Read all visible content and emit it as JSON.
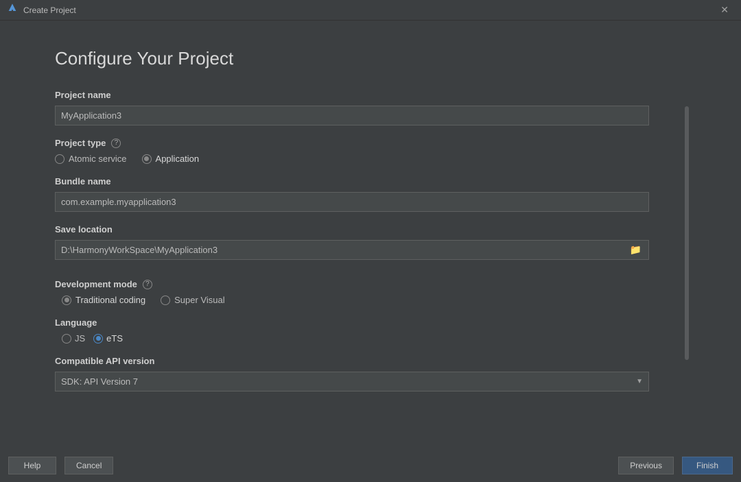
{
  "window": {
    "title": "Create Project"
  },
  "page": {
    "title": "Configure Your Project"
  },
  "fields": {
    "projectName": {
      "label": "Project name",
      "value": "MyApplication3"
    },
    "projectType": {
      "label": "Project type",
      "options": [
        {
          "label": "Atomic service",
          "selected": false
        },
        {
          "label": "Application",
          "selected": true
        }
      ]
    },
    "bundleName": {
      "label": "Bundle name",
      "value": "com.example.myapplication3"
    },
    "saveLocation": {
      "label": "Save location",
      "value": "D:\\HarmonyWorkSpace\\MyApplication3"
    },
    "devMode": {
      "label": "Development mode",
      "options": [
        {
          "label": "Traditional coding",
          "selected": true
        },
        {
          "label": "Super Visual",
          "selected": false
        }
      ]
    },
    "language": {
      "label": "Language",
      "options": [
        {
          "label": "JS",
          "selected": false
        },
        {
          "label": "eTS",
          "selected": true
        }
      ]
    },
    "apiVersion": {
      "label": "Compatible API version",
      "value": "SDK: API Version 7"
    }
  },
  "buttons": {
    "help": "Help",
    "cancel": "Cancel",
    "previous": "Previous",
    "finish": "Finish"
  }
}
